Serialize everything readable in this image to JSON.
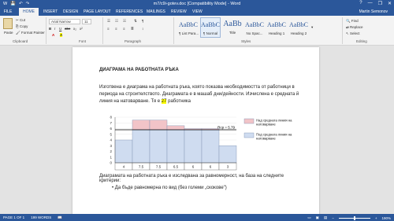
{
  "window": {
    "title": "m7/c9i-gotev.doc [Compatibility Mode] - Word",
    "controls": [
      "?",
      "—",
      "❐",
      "✕"
    ]
  },
  "quick_access": [
    "W",
    "💾",
    "↶",
    "↷"
  ],
  "tabs": [
    "FILE",
    "HOME",
    "INSERT",
    "DESIGN",
    "PAGE LAYOUT",
    "REFERENCES",
    "MAILINGS",
    "REVIEW",
    "VIEW"
  ],
  "user": "Martin Semonov",
  "ribbon": {
    "clipboard": {
      "paste": "Paste",
      "cut": "Cut",
      "copy": "Copy",
      "format_painter": "Format Painter",
      "label": "Clipboard"
    },
    "font": {
      "name": "Arial Narrow",
      "size": "11",
      "label": "Font",
      "buttons": [
        "B",
        "I",
        "U",
        "abc",
        "x₂",
        "x²",
        "A",
        "A"
      ]
    },
    "paragraph": {
      "label": "Paragraph"
    },
    "styles": {
      "label": "Styles",
      "items": [
        {
          "preview": "AaBbCcDc",
          "name": "¶ List Para..."
        },
        {
          "preview": "AaBbCcDc",
          "name": "¶ Normal"
        },
        {
          "preview": "AaBb",
          "name": "Title"
        },
        {
          "preview": "AaBbCcDc",
          "name": "No Spac..."
        },
        {
          "preview": "AaBbC",
          "name": "Heading 1"
        },
        {
          "preview": "AaBbCc",
          "name": "Heading 2"
        }
      ]
    },
    "editing": {
      "find": "Find",
      "replace": "Replace",
      "select": "Select",
      "label": "Editing"
    }
  },
  "document": {
    "heading": "ДИАГРАМА НА РАБОТНАТА РЪКА",
    "para_before": "Изготвена е диаграма на работната ръка, която показва необходимостта от работници в периода на строителството. Диаграмата е в машаб дни/дейности. Изчислена е средната й линия на натоварване. Тя е ",
    "para_highlight": "27",
    "para_after": " работника",
    "para2": "Диаграмата на работната ръка е изследвана за равномерност, на база на следните критерии:",
    "bullet": "•     Да бъде равномерна по вид (без големи „скокове\")"
  },
  "chart_data": {
    "type": "bar",
    "categories": [
      "4",
      "7.5",
      "7.5",
      "6.5",
      "6",
      "6",
      "3"
    ],
    "values": [
      4,
      7.5,
      7.5,
      6.5,
      6,
      6,
      3
    ],
    "ylim": [
      0,
      8
    ],
    "yticks": [
      "0",
      "1",
      "2",
      "3",
      "4",
      "5",
      "6",
      "7",
      "8"
    ],
    "average": 5.79,
    "average_label": "Rcp = 5.79",
    "legend": [
      {
        "label": "Над средната линия на натоварване",
        "color": "#f2c4c8"
      },
      {
        "label": "Под средната линия на натоварване",
        "color": "#cfdcf0"
      }
    ],
    "legend_position": "right",
    "colors": {
      "above": "#f2c4c8",
      "below": "#cfdcf0",
      "border": "#7a8fb0"
    }
  },
  "status": {
    "page": "PAGE 1 OF 1",
    "words": "199 WORDS",
    "zoom": "190%"
  }
}
